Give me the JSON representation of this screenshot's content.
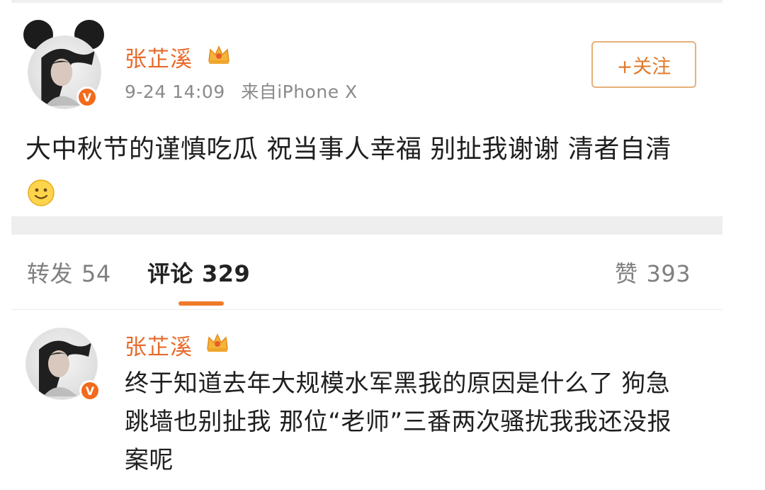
{
  "post": {
    "author": "张芷溪",
    "date": "9-24 14:09",
    "source": "来自iPhone X",
    "follow_label": "+关注",
    "text": "大中秋节的谨慎吃瓜 祝当事人幸福 别扯我谢谢 清者自清"
  },
  "tabs": {
    "repost_label": "转发",
    "repost_count": "54",
    "comment_label": "评论",
    "comment_count": "329",
    "like_label": "赞",
    "like_count": "393"
  },
  "comment": {
    "author": "张芷溪",
    "text": "终于知道去年大规模水军黑我的原因是什么了 狗急跳墙也别扯我 那位“老师”三番两次骚扰我我还没报案呢"
  },
  "badges": {
    "verified": "V"
  },
  "icons": {
    "crown": "crown-icon",
    "verified": "verified-badge-icon",
    "emoji": "smiley-emoji-icon"
  },
  "colors": {
    "name": "#e86a2b",
    "accent": "#ef7a2a",
    "follow_border": "#e6b07a",
    "meta": "#8a8a8a"
  }
}
